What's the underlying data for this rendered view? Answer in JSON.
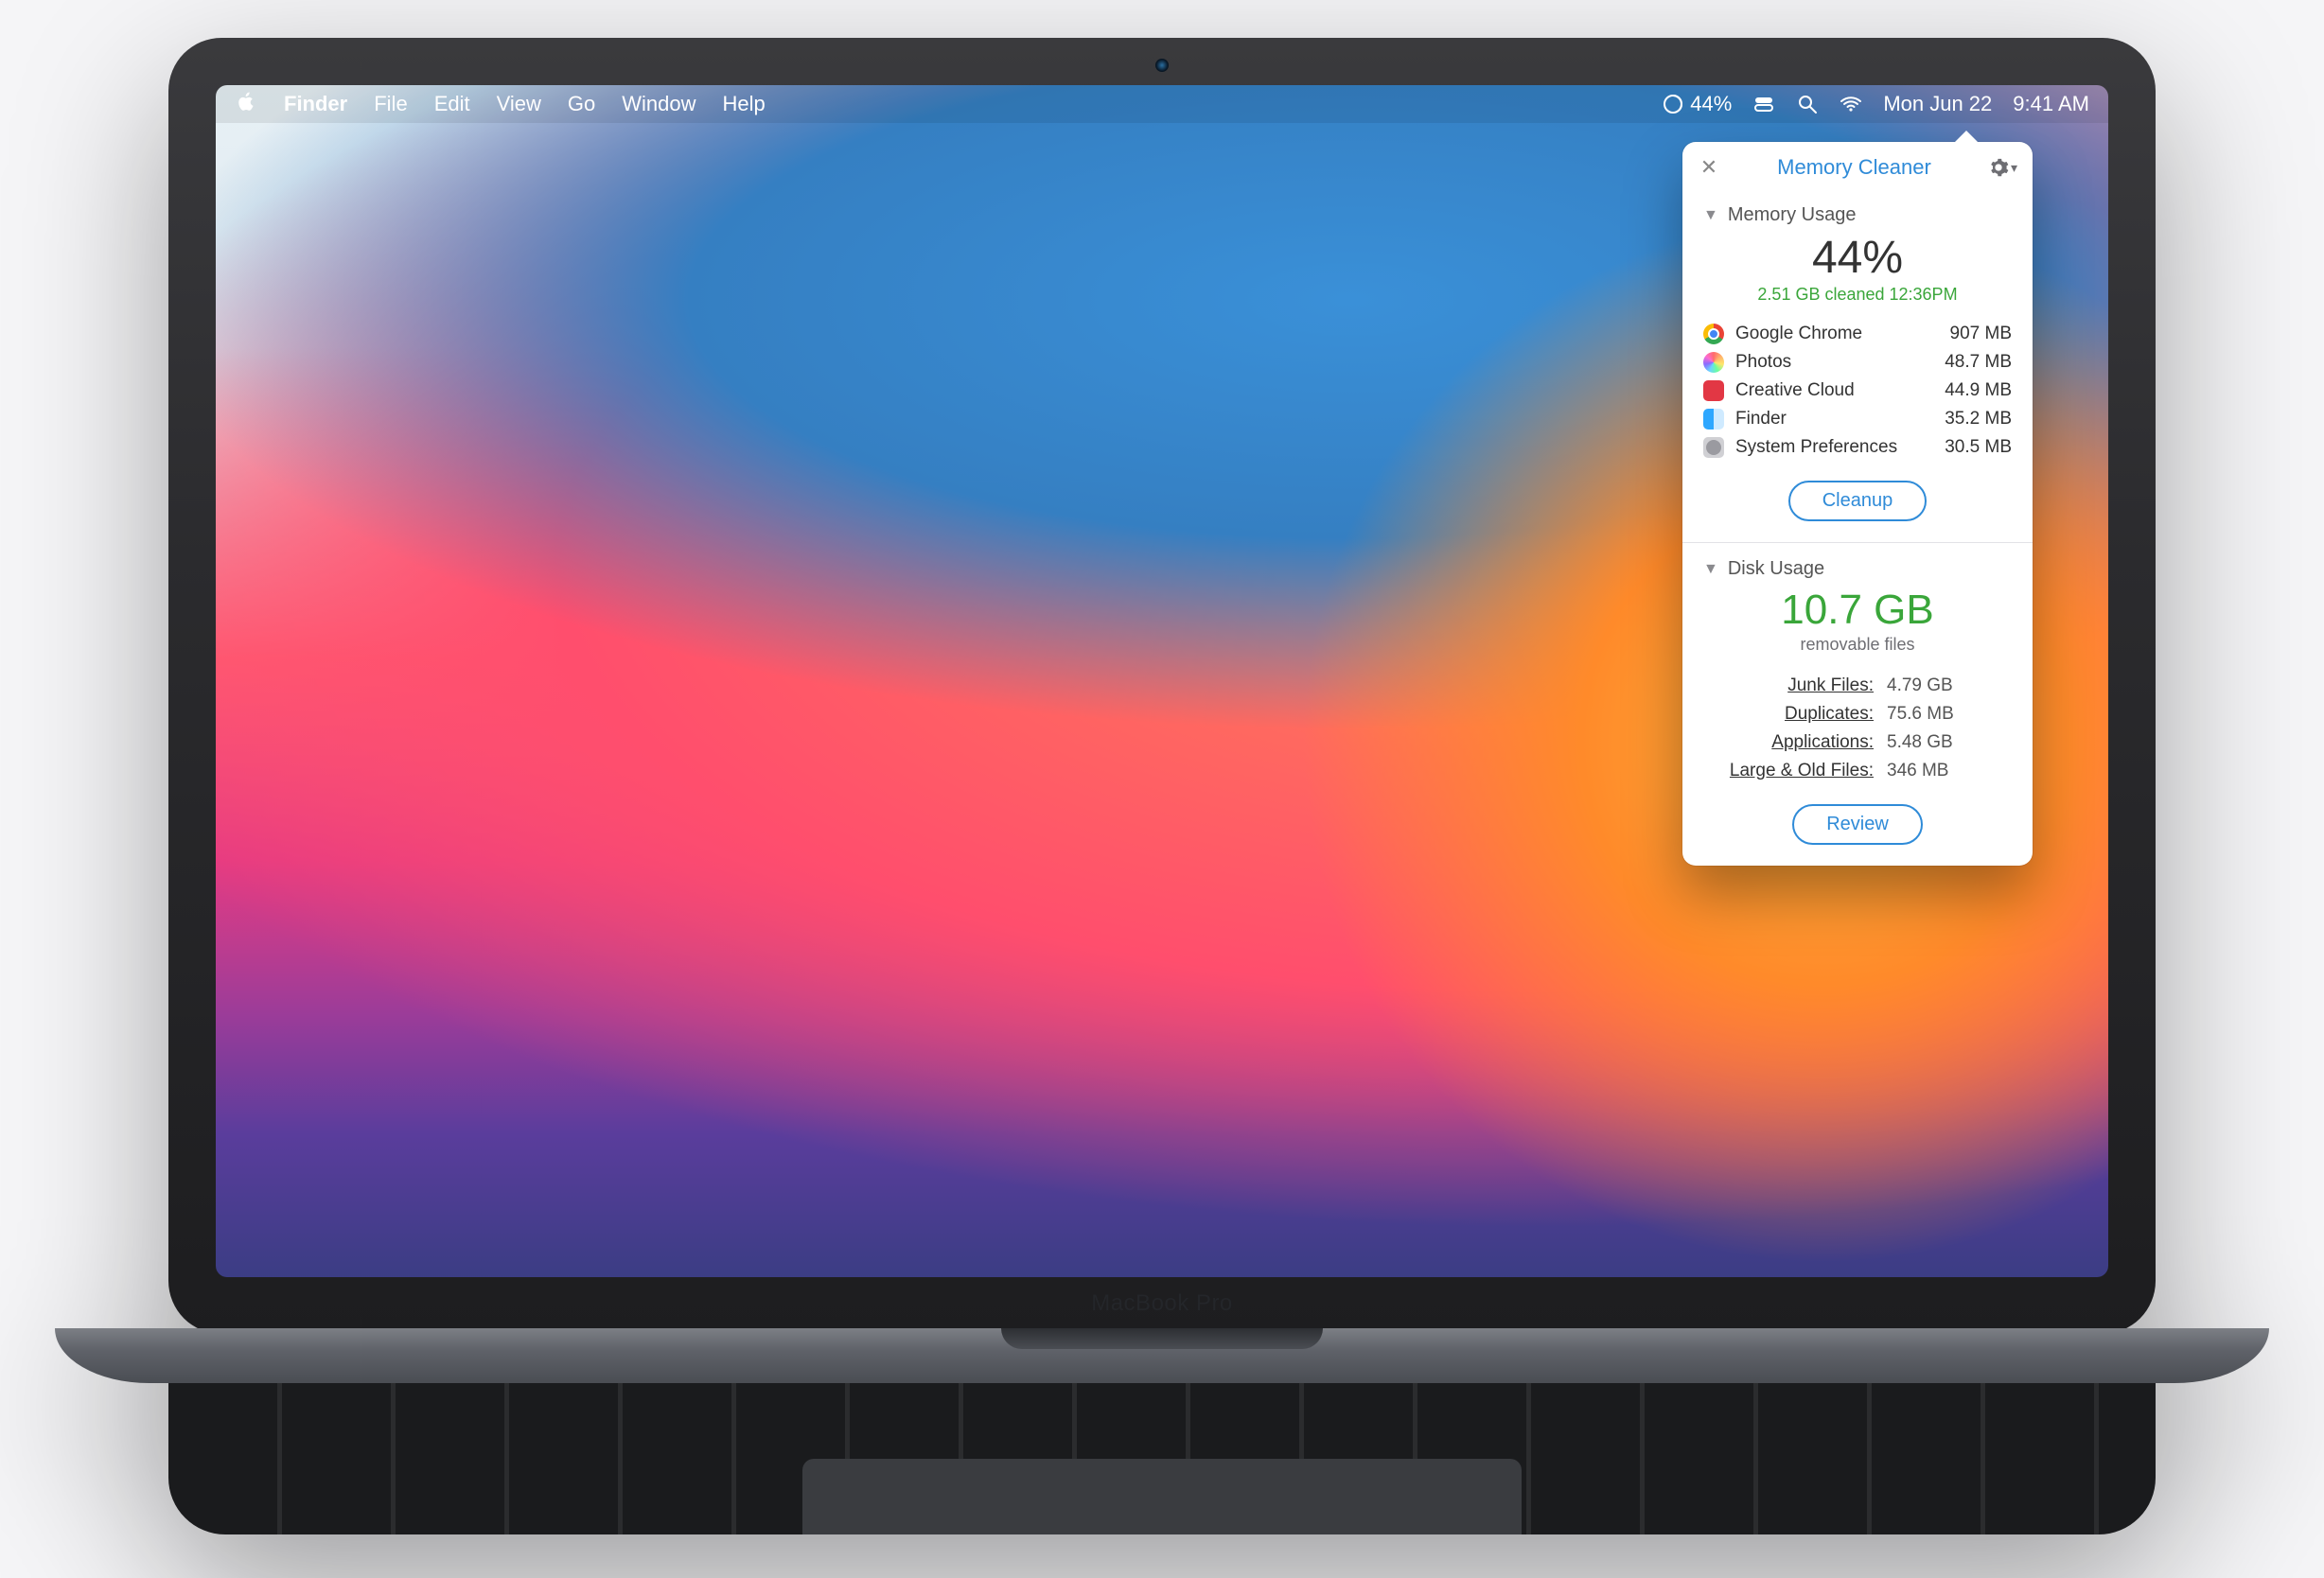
{
  "menubar": {
    "app": "Finder",
    "items": [
      "File",
      "Edit",
      "View",
      "Go",
      "Window",
      "Help"
    ],
    "status_pct": "44%",
    "date": "Mon Jun 22",
    "time": "9:41 AM"
  },
  "popover": {
    "title": "Memory Cleaner",
    "memory": {
      "heading": "Memory Usage",
      "percent": "44%",
      "cleaned_line": "2.51 GB cleaned 12:36PM",
      "processes": [
        {
          "name": "Google Chrome",
          "size": "907 MB"
        },
        {
          "name": "Photos",
          "size": "48.7 MB"
        },
        {
          "name": "Creative Cloud",
          "size": "44.9 MB"
        },
        {
          "name": "Finder",
          "size": "35.2 MB"
        },
        {
          "name": "System Preferences",
          "size": "30.5 MB"
        }
      ],
      "cleanup_label": "Cleanup"
    },
    "disk": {
      "heading": "Disk Usage",
      "removable_value": "10.7 GB",
      "removable_caption": "removable files",
      "rows": [
        {
          "label": "Junk Files:",
          "value": "4.79 GB"
        },
        {
          "label": "Duplicates:",
          "value": "75.6 MB"
        },
        {
          "label": "Applications:",
          "value": "5.48 GB"
        },
        {
          "label": "Large & Old Files:",
          "value": "346 MB"
        }
      ],
      "review_label": "Review"
    }
  },
  "hardware_label": "MacBook Pro"
}
